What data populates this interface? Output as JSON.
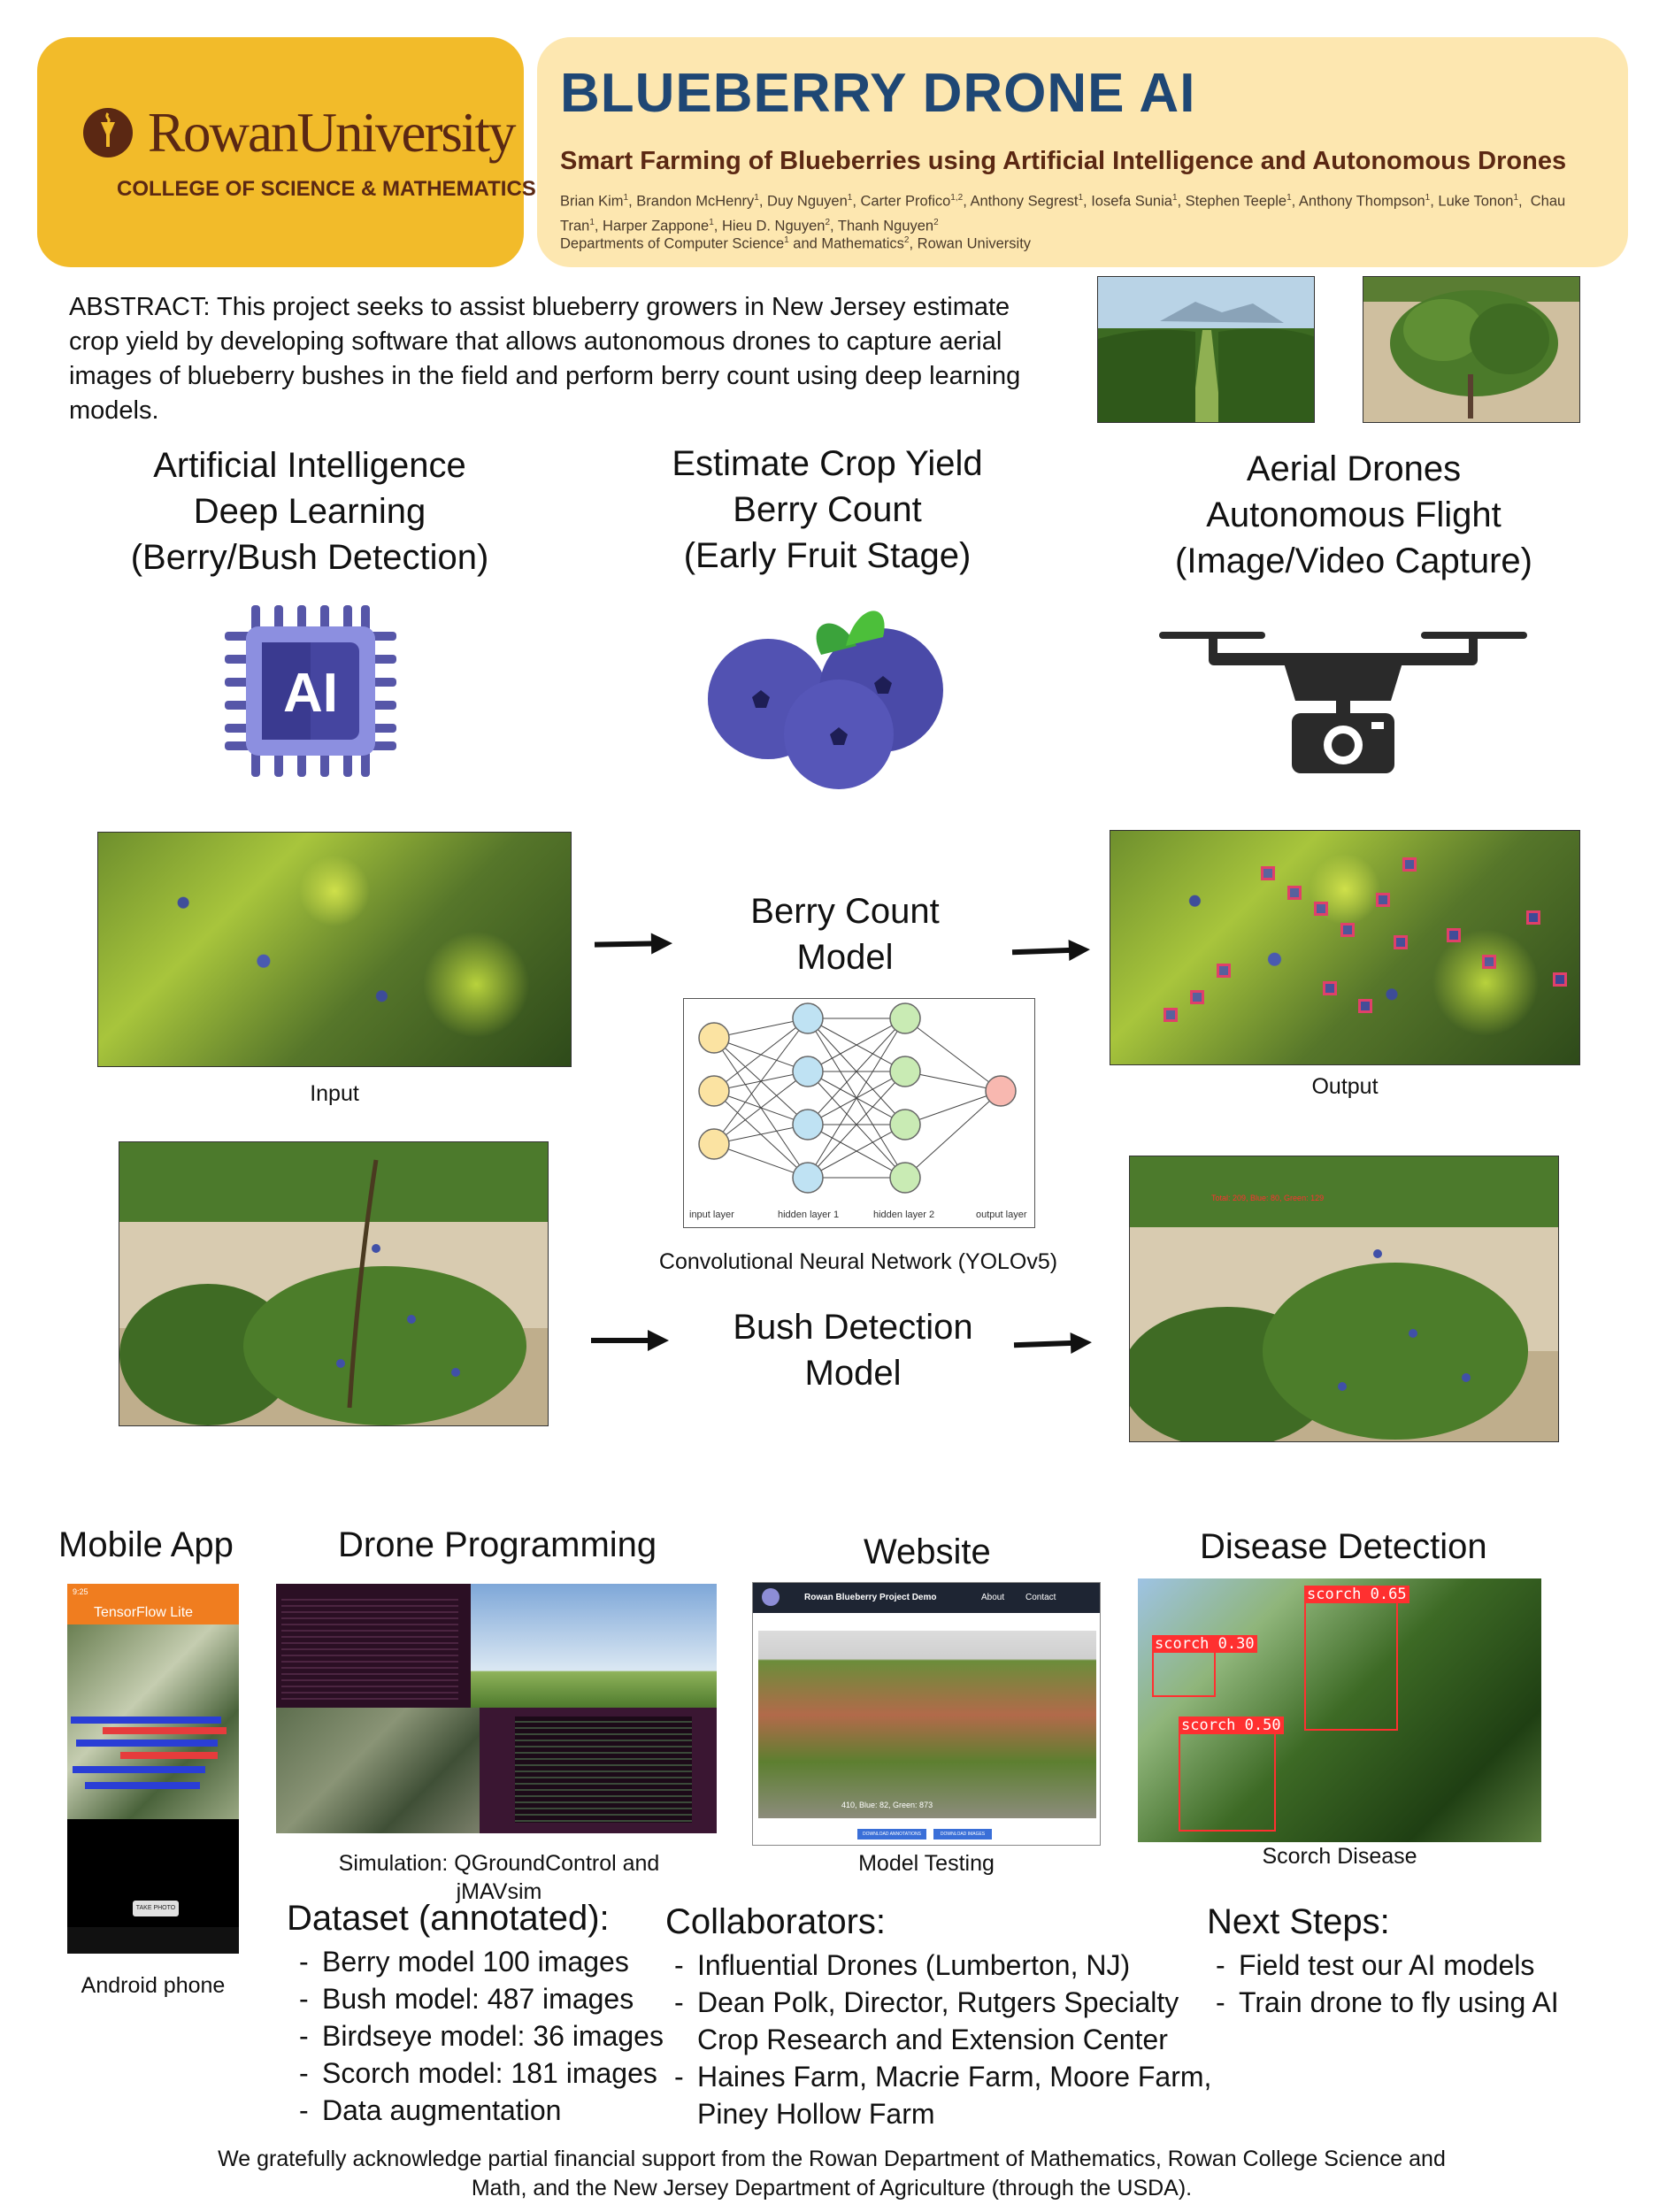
{
  "header": {
    "logo_name": "RowanUniversity",
    "logo_college": "COLLEGE OF SCIENCE & MATHEMATICS",
    "title": "BLUEBERRY DRONE AI",
    "subtitle": "Smart Farming of Blueberries using Artificial Intelligence and Autonomous Drones",
    "authors_html": "Brian Kim<sup>1</sup>, Brandon McHenry<sup>1</sup>, Duy Nguyen<sup>1</sup>, Carter Profico<sup>1,2</sup>, Anthony Segrest<sup>1</sup>, Iosefa Sunia<sup>1</sup>, Stephen Teeple<sup>1</sup>, Anthony Thompson<sup>1</sup>, Luke Tonon<sup>1</sup>,&nbsp; Chau Tran<sup>1</sup>, Harper Zappone<sup>1</sup>, Hieu D. Nguyen<sup>2</sup>, Thanh Nguyen<sup>2</sup>",
    "departments_html": "Departments of Computer Science<sup>1</sup> and Mathematics<sup>2</sup>, Rowan University"
  },
  "abstract": "ABSTRACT: This project seeks to assist blueberry growers in New Jersey estimate crop yield by developing software that allows autonomous drones to capture aerial images of blueberry bushes in the field and perform berry count using deep learning models.",
  "pillars": [
    {
      "line1": "Artificial Intelligence",
      "line2": "Deep Learning",
      "line3": "(Berry/Bush Detection)",
      "icon": "ai-chip-icon",
      "icon_text": "AI"
    },
    {
      "line1": "Estimate Crop Yield",
      "line2": "Berry Count",
      "line3": "(Early Fruit Stage)",
      "icon": "blueberries-icon"
    },
    {
      "line1": "Aerial Drones",
      "line2": "Autonomous Flight",
      "line3": "(Image/Video Capture)",
      "icon": "drone-camera-icon"
    }
  ],
  "pipeline": {
    "input_caption": "Input",
    "output_caption": "Output",
    "berry_model_line1": "Berry Count",
    "berry_model_line2": "Model",
    "bush_model_line1": "Bush Detection",
    "bush_model_line2": "Model",
    "cnn_caption": "Convolutional Neural Network (YOLOv5)",
    "nn_labels": [
      "input layer",
      "hidden layer 1",
      "hidden layer 2",
      "output layer"
    ],
    "bush_output_overlay": "Total: 209, Blue: 80, Green: 129"
  },
  "sections": {
    "mobile_app": {
      "title": "Mobile App",
      "caption": "Android phone",
      "app_name": "TensorFlow Lite",
      "button": "TAKE PHOTO",
      "status_time": "9:25"
    },
    "drone_programming": {
      "title": "Drone Programming",
      "caption": "Simulation: QGroundControl and jMAVsim"
    },
    "website": {
      "title": "Website",
      "caption": "Model Testing",
      "nav_title": "Rowan Blueberry Project Demo",
      "nav_about": "About",
      "nav_contact": "Contact",
      "overlay": "410, Blue: 82, Green: 873",
      "btn1": "DOWNLOAD ANNOTATIONS",
      "btn2": "DOWNLOAD IMAGES"
    },
    "disease": {
      "title": "Disease Detection",
      "caption": "Scorch Disease",
      "labels": [
        "scorch 0.65",
        "scorch 0.30",
        "scorch 0.50"
      ]
    }
  },
  "dataset": {
    "title": "Dataset (annotated):",
    "items": [
      "Berry model 100 images",
      "Bush model: 487 images",
      "Birdseye model: 36 images",
      "Scorch model: 181 images",
      "Data augmentation"
    ]
  },
  "collaborators": {
    "title": "Collaborators:",
    "items": [
      "Influential Drones (Lumberton, NJ)",
      "Dean Polk, Director, Rutgers Specialty Crop Research and Extension Center",
      "Haines Farm, Macrie Farm, Moore Farm, Piney Hollow Farm"
    ]
  },
  "next_steps": {
    "title": "Next Steps:",
    "items": [
      "Field test our AI models",
      "Train drone to fly using AI"
    ]
  },
  "acknowledgement": "We gratefully acknowledge partial financial support from the Rowan Department of Mathematics, Rowan College Science and Math, and the New Jersey Department of Agriculture (through the USDA).",
  "colors": {
    "gold": "#f2bb2a",
    "cream": "#fde7b0",
    "navy": "#1f4774",
    "brown": "#5b2813",
    "purple": "#5656a8"
  }
}
